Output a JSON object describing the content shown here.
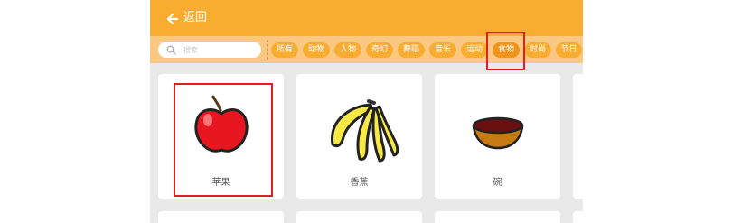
{
  "header": {
    "back_label": "返回"
  },
  "search": {
    "placeholder": "搜索"
  },
  "categories": [
    "所有",
    "动物",
    "人物",
    "奇幻",
    "舞蹈",
    "音乐",
    "运动",
    "食物",
    "时尚",
    "节日"
  ],
  "selected_category": "食物",
  "items": [
    {
      "label": "苹果",
      "icon": "apple-icon"
    },
    {
      "label": "香蕉",
      "icon": "banana-icon"
    },
    {
      "label": "碗",
      "icon": "bowl-icon"
    }
  ],
  "colors": {
    "accent": "#f8ad31",
    "filter_bar": "#fbc882",
    "highlight": "#e02020"
  }
}
